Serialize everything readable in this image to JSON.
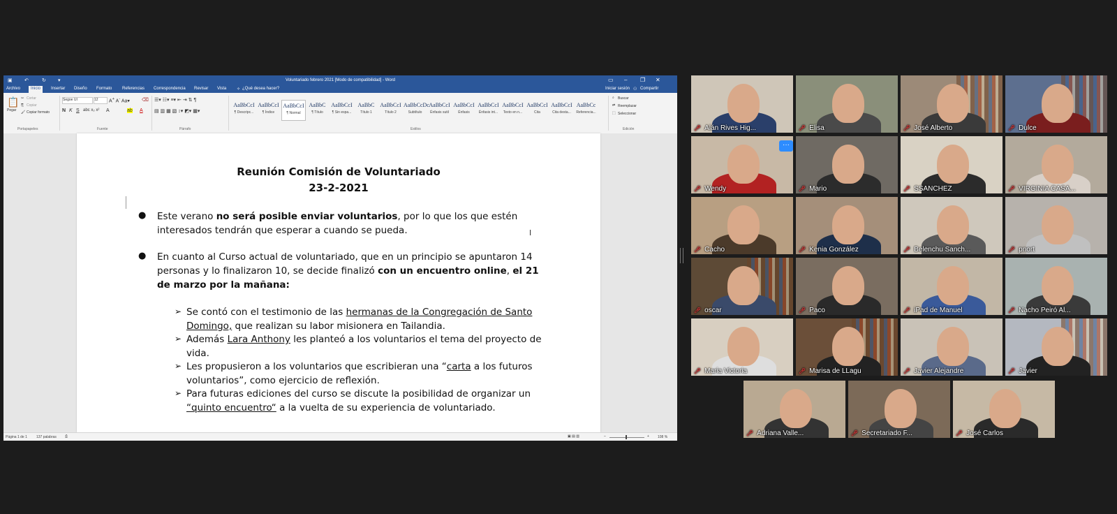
{
  "word": {
    "window_title": "Voluntariado febrero 2021 [Modo de compatibilidad] - Word",
    "signin": "Iniciar sesión",
    "share": "Compartir",
    "tabs": [
      "Archivo",
      "Inicio",
      "Insertar",
      "Diseño",
      "Formato",
      "Referencias",
      "Correspondencia",
      "Revisar",
      "Vista"
    ],
    "tellme": "¿Qué desea hacer?",
    "clipboard": {
      "paste": "Pegar",
      "cut": "Cortar",
      "copy": "Copiar",
      "format_painter": "Copiar formato",
      "group": "Portapapeles"
    },
    "font": {
      "name": "Segoe UI",
      "size": "12",
      "group": "Fuente"
    },
    "paragraph_group": "Párrafo",
    "styles_group": "Estilos",
    "styles": [
      {
        "sample": "AaBbCcI",
        "name": "¶ Descripc..."
      },
      {
        "sample": "AaBbCcI",
        "name": "¶ Índice"
      },
      {
        "sample": "AaBbCcI",
        "name": "¶ Normal"
      },
      {
        "sample": "AaBbC",
        "name": "¶ Título"
      },
      {
        "sample": "AaBbCcI",
        "name": "¶ Sin espa..."
      },
      {
        "sample": "AaBbC",
        "name": "Título 1"
      },
      {
        "sample": "AaBbCcI",
        "name": "Título 2"
      },
      {
        "sample": "AaBbCcDc",
        "name": "Subtítulo"
      },
      {
        "sample": "AaBbCcI",
        "name": "Énfasis sutil"
      },
      {
        "sample": "AaBbCcI",
        "name": "Énfasis"
      },
      {
        "sample": "AaBbCcI",
        "name": "Énfasis int..."
      },
      {
        "sample": "AaBbCcI",
        "name": "Texto en n..."
      },
      {
        "sample": "AaBbCcI",
        "name": "Cita"
      },
      {
        "sample": "AaBbCcI",
        "name": "Cita desta..."
      },
      {
        "sample": "AaBbCc",
        "name": "Referencia..."
      }
    ],
    "editing": {
      "find": "Buscar",
      "replace": "Reemplazar",
      "select": "Seleccionar",
      "group": "Edición"
    },
    "status": {
      "page": "Página 1 de 1",
      "words": "137 palabras",
      "zoom": "108 %"
    },
    "document": {
      "heading1": "Reunión Comisión de Voluntariado",
      "heading2": "23-2-2021",
      "bullet1": {
        "a": "Este verano ",
        "b": "no será posible enviar voluntarios",
        "c": ", por lo que los que estén interesados tendrán que esperar a cuando se pueda."
      },
      "bullet2": {
        "a": "En cuanto al Curso actual de voluntariado, que en un principio se apuntaron 14 personas y lo finalizaron 10, se decide finalizó ",
        "b": "con un encuentro online",
        "c": ", ",
        "d": "el 21 de marzo por la mañana:"
      },
      "sub1": {
        "a": "Se contó con el testimonio de las ",
        "b": "hermanas de la Congregación de Santo Domingo,",
        "c": " que realizan su labor misionera en Tailandia."
      },
      "sub2": {
        "a": "Además ",
        "b": "Lara Anthony",
        "c": " les planteó a los voluntarios el tema del proyecto de vida."
      },
      "sub3": {
        "a": "Les propusieron a los voluntarios que escribieran una “",
        "b": "carta",
        "c": " a los futuros voluntarios”, como ejercicio de reflexión."
      },
      "sub4": {
        "a": "Para futuras ediciones del curso se discute la posibilidad de organizar un ",
        "b": "“quinto encuentro“",
        "c": " a la vuelta de su experiencia de voluntariado."
      }
    }
  },
  "participants": [
    {
      "name": "Alán Rives Hig..."
    },
    {
      "name": "Elisa"
    },
    {
      "name": "José Alberto"
    },
    {
      "name": "Dulce"
    },
    {
      "name": "Wendy"
    },
    {
      "name": "Mario"
    },
    {
      "name": "SSANCHEZ"
    },
    {
      "name": "VIRGINIA CASA..."
    },
    {
      "name": "Cacho"
    },
    {
      "name": "Kenia González"
    },
    {
      "name": "Belenchu Sanch..."
    },
    {
      "name": "pnort"
    },
    {
      "name": "oscar"
    },
    {
      "name": "Paco"
    },
    {
      "name": "iPad de Manuel"
    },
    {
      "name": "Nacho Peiró Al..."
    },
    {
      "name": "Maria Victoria"
    },
    {
      "name": "Marisa de LLagu"
    },
    {
      "name": "Javier Alejandre"
    },
    {
      "name": "Javier"
    },
    {
      "name": "Adriana   Valle..."
    },
    {
      "name": "Secretariado F..."
    },
    {
      "name": "José Carlos"
    }
  ],
  "more_button": "···",
  "colors": {
    "word_blue": "#2b579a",
    "active_speaker": "#d4dc3a",
    "muted_mic": "#e43b3b",
    "zoom_blue": "#2d8cff"
  }
}
